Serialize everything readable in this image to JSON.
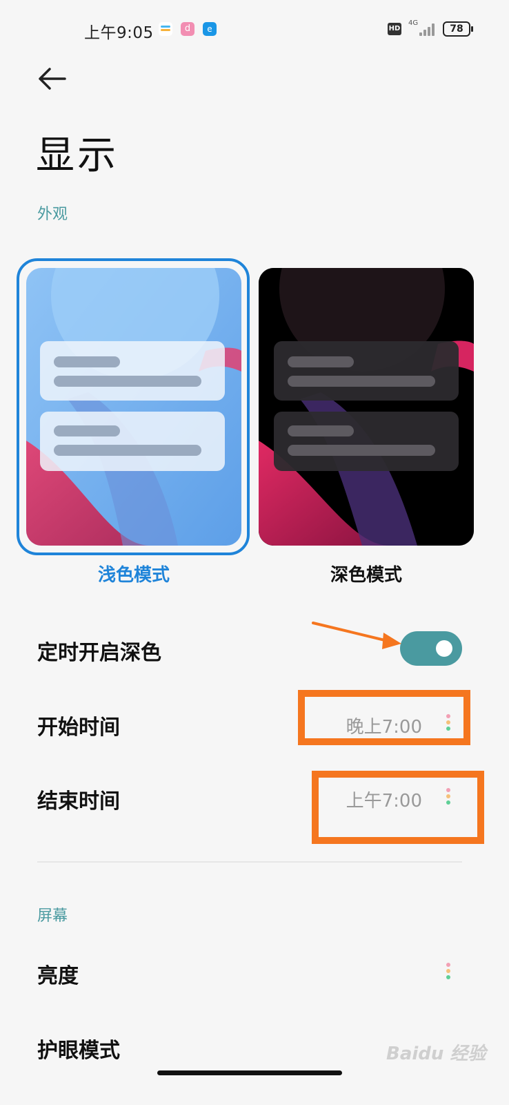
{
  "status_bar": {
    "time": "上午9:05",
    "hd": "HD",
    "network": "4G",
    "battery": "78",
    "notif_app_2": "d",
    "notif_app_3": "e"
  },
  "header": {
    "back_icon": "back-arrow-icon",
    "title": "显示"
  },
  "appearance": {
    "section_label": "外观",
    "light_mode": {
      "label": "浅色模式",
      "selected": true,
      "accent": "#1f84d9"
    },
    "dark_mode": {
      "label": "深色模式",
      "selected": false
    }
  },
  "schedule": {
    "toggle_label": "定时开启深色",
    "toggle_on": true,
    "toggle_color": "#4a9aa0",
    "start_label": "开始时间",
    "start_value": "晚上7:00",
    "end_label": "结束时间",
    "end_value": "上午7:00"
  },
  "screen": {
    "section_label": "屏幕",
    "brightness_label": "亮度",
    "eye_care_label": "护眼模式"
  },
  "annotation_color": "#f5761f",
  "watermark": "Baidu 经验"
}
